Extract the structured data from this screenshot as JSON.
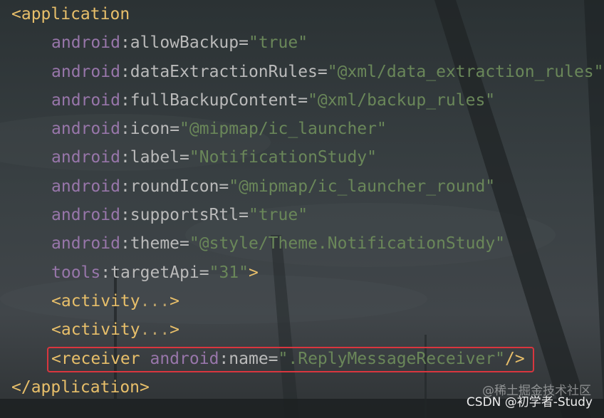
{
  "lines": {
    "open_tag": "<application",
    "allowBackup": {
      "prefix": "android",
      "attr": "allowBackup",
      "value": "\"true\""
    },
    "dataExtractionRules": {
      "prefix": "android",
      "attr": "dataExtractionRules",
      "value": "\"@xml/data_extraction_rules\""
    },
    "fullBackupContent": {
      "prefix": "android",
      "attr": "fullBackupContent",
      "value": "\"@xml/backup_rules\""
    },
    "icon": {
      "prefix": "android",
      "attr": "icon",
      "value": "\"@mipmap/ic_launcher\""
    },
    "label": {
      "prefix": "android",
      "attr": "label",
      "value": "\"NotificationStudy\""
    },
    "roundIcon": {
      "prefix": "android",
      "attr": "roundIcon",
      "value": "\"@mipmap/ic_launcher_round\""
    },
    "supportsRtl": {
      "prefix": "android",
      "attr": "supportsRtl",
      "value": "\"true\""
    },
    "theme": {
      "prefix": "android",
      "attr": "theme",
      "value": "\"@style/Theme.NotificationStudy\""
    },
    "targetApi": {
      "prefix": "tools",
      "attr": "targetApi",
      "value": "\"31\"",
      "close": ">"
    },
    "activity1": {
      "tag": "<activity",
      "dots": "...",
      "close": ">"
    },
    "activity2": {
      "tag": "<activity",
      "dots": "...",
      "close": ">"
    },
    "receiver": {
      "tag": "<receiver",
      "prefix": "android",
      "attr": "name",
      "value": "\".ReplyMessageReceiver\"",
      "close": "/>"
    },
    "close_tag": "</application>"
  },
  "watermarks": {
    "juejin": "@稀土掘金技术社区",
    "csdn": "CSDN @初学者-Study"
  },
  "colors": {
    "tag": "#e8bf6a",
    "namespace": "#9876aa",
    "attribute": "#bababa",
    "value": "#6a8759",
    "highlight_border": "#d9363e"
  }
}
